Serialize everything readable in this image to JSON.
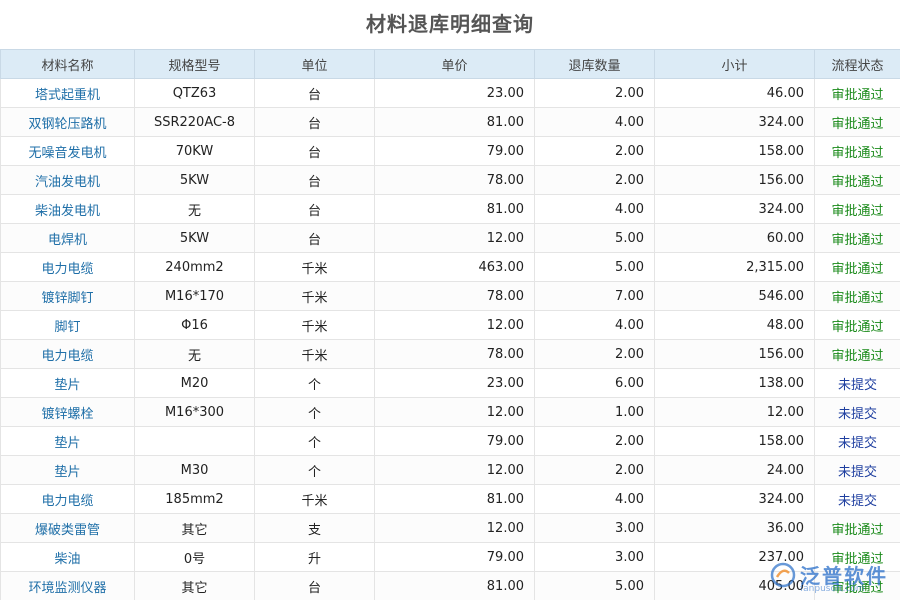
{
  "page_title": "材料退库明细查询",
  "columns": [
    "材料名称",
    "规格型号",
    "单位",
    "单价",
    "退库数量",
    "小计",
    "流程状态"
  ],
  "rows": [
    {
      "name": "塔式起重机",
      "spec": "QTZ63",
      "unit": "台",
      "price": "23.00",
      "qty": "2.00",
      "subtotal": "46.00",
      "status": "审批通过"
    },
    {
      "name": "双钢轮压路机",
      "spec": "SSR220AC-8",
      "unit": "台",
      "price": "81.00",
      "qty": "4.00",
      "subtotal": "324.00",
      "status": "审批通过"
    },
    {
      "name": "无噪音发电机",
      "spec": "70KW",
      "unit": "台",
      "price": "79.00",
      "qty": "2.00",
      "subtotal": "158.00",
      "status": "审批通过"
    },
    {
      "name": "汽油发电机",
      "spec": "5KW",
      "unit": "台",
      "price": "78.00",
      "qty": "2.00",
      "subtotal": "156.00",
      "status": "审批通过"
    },
    {
      "name": "柴油发电机",
      "spec": "无",
      "unit": "台",
      "price": "81.00",
      "qty": "4.00",
      "subtotal": "324.00",
      "status": "审批通过"
    },
    {
      "name": "电焊机",
      "spec": "5KW",
      "unit": "台",
      "price": "12.00",
      "qty": "5.00",
      "subtotal": "60.00",
      "status": "审批通过"
    },
    {
      "name": "电力电缆",
      "spec": "240mm2",
      "unit": "千米",
      "price": "463.00",
      "qty": "5.00",
      "subtotal": "2,315.00",
      "status": "审批通过"
    },
    {
      "name": "镀锌脚钉",
      "spec": "M16*170",
      "unit": "千米",
      "price": "78.00",
      "qty": "7.00",
      "subtotal": "546.00",
      "status": "审批通过"
    },
    {
      "name": "脚钉",
      "spec": "Φ16",
      "unit": "千米",
      "price": "12.00",
      "qty": "4.00",
      "subtotal": "48.00",
      "status": "审批通过"
    },
    {
      "name": "电力电缆",
      "spec": "无",
      "unit": "千米",
      "price": "78.00",
      "qty": "2.00",
      "subtotal": "156.00",
      "status": "审批通过"
    },
    {
      "name": "垫片",
      "spec": "M20",
      "unit": "个",
      "price": "23.00",
      "qty": "6.00",
      "subtotal": "138.00",
      "status": "未提交"
    },
    {
      "name": "镀锌螺栓",
      "spec": "M16*300",
      "unit": "个",
      "price": "12.00",
      "qty": "1.00",
      "subtotal": "12.00",
      "status": "未提交"
    },
    {
      "name": "垫片",
      "spec": "",
      "unit": "个",
      "price": "79.00",
      "qty": "2.00",
      "subtotal": "158.00",
      "status": "未提交"
    },
    {
      "name": "垫片",
      "spec": "M30",
      "unit": "个",
      "price": "12.00",
      "qty": "2.00",
      "subtotal": "24.00",
      "status": "未提交"
    },
    {
      "name": "电力电缆",
      "spec": "185mm2",
      "unit": "千米",
      "price": "81.00",
      "qty": "4.00",
      "subtotal": "324.00",
      "status": "未提交"
    },
    {
      "name": "爆破类雷管",
      "spec": "其它",
      "unit": "支",
      "price": "12.00",
      "qty": "3.00",
      "subtotal": "36.00",
      "status": "审批通过"
    },
    {
      "name": "柴油",
      "spec": "0号",
      "unit": "升",
      "price": "79.00",
      "qty": "3.00",
      "subtotal": "237.00",
      "status": "审批通过"
    },
    {
      "name": "环境监测仪器",
      "spec": "其它",
      "unit": "台",
      "price": "81.00",
      "qty": "5.00",
      "subtotal": "405.00",
      "status": "审批通过"
    }
  ],
  "status_colors": {
    "审批通过": "#1a8a1a",
    "未提交": "#1f3fa0"
  },
  "accent": {
    "header_bg": "#dcebf6",
    "name_link": "#1f6fa8"
  },
  "watermark": {
    "brand": "泛普软件",
    "url": "fanpusoft.com"
  }
}
